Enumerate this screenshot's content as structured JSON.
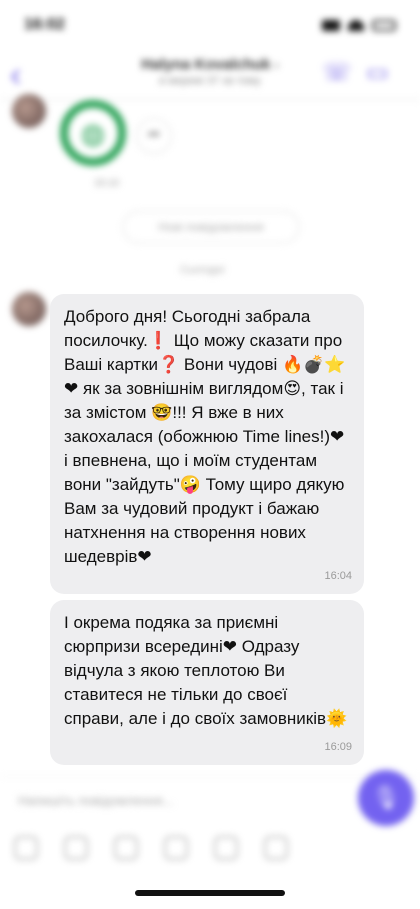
{
  "status_bar": {
    "time": "16:02"
  },
  "header": {
    "back_icon": "chevron-left-icon",
    "contact_name": "Halyna Kovalchuk",
    "last_seen": "в мережі 37 хв тому",
    "call_icon": "phone-icon",
    "video_icon": "video-camera-icon"
  },
  "conversation": {
    "sticker_time": "15:10",
    "ticket_label": "Нові повідомлення",
    "day_separator": "Сьогодні"
  },
  "messages": [
    {
      "text": "Доброго дня! Сьогодні забрала посилочку.❗ Що можу сказати про Ваші картки❓ Вони чудові 🔥💣⭐❤ як за зовнішнім виглядом😍, так і за змістом 🤓!!! Я вже в них закохалася (обожнюю Time lines!)❤ і впевнена, що і моїм студентам вони \"зайдуть\"🤪 Тому щиро дякую Вам за чудовий продукт і бажаю натхнення на створення нових шедеврів❤",
      "time": "16:04"
    },
    {
      "text": "І окрема подяка за приємні сюрпризи всередині❤ Одразу відчула з якою теплотою Ви ставитеся не тільки до своєї справи, але і до своїх замовників🌞",
      "time": "16:09"
    }
  ],
  "composer": {
    "placeholder": "Напишіть повідомлення...",
    "send_icon": "microphone-icon"
  },
  "accent_color": "#7362f0"
}
